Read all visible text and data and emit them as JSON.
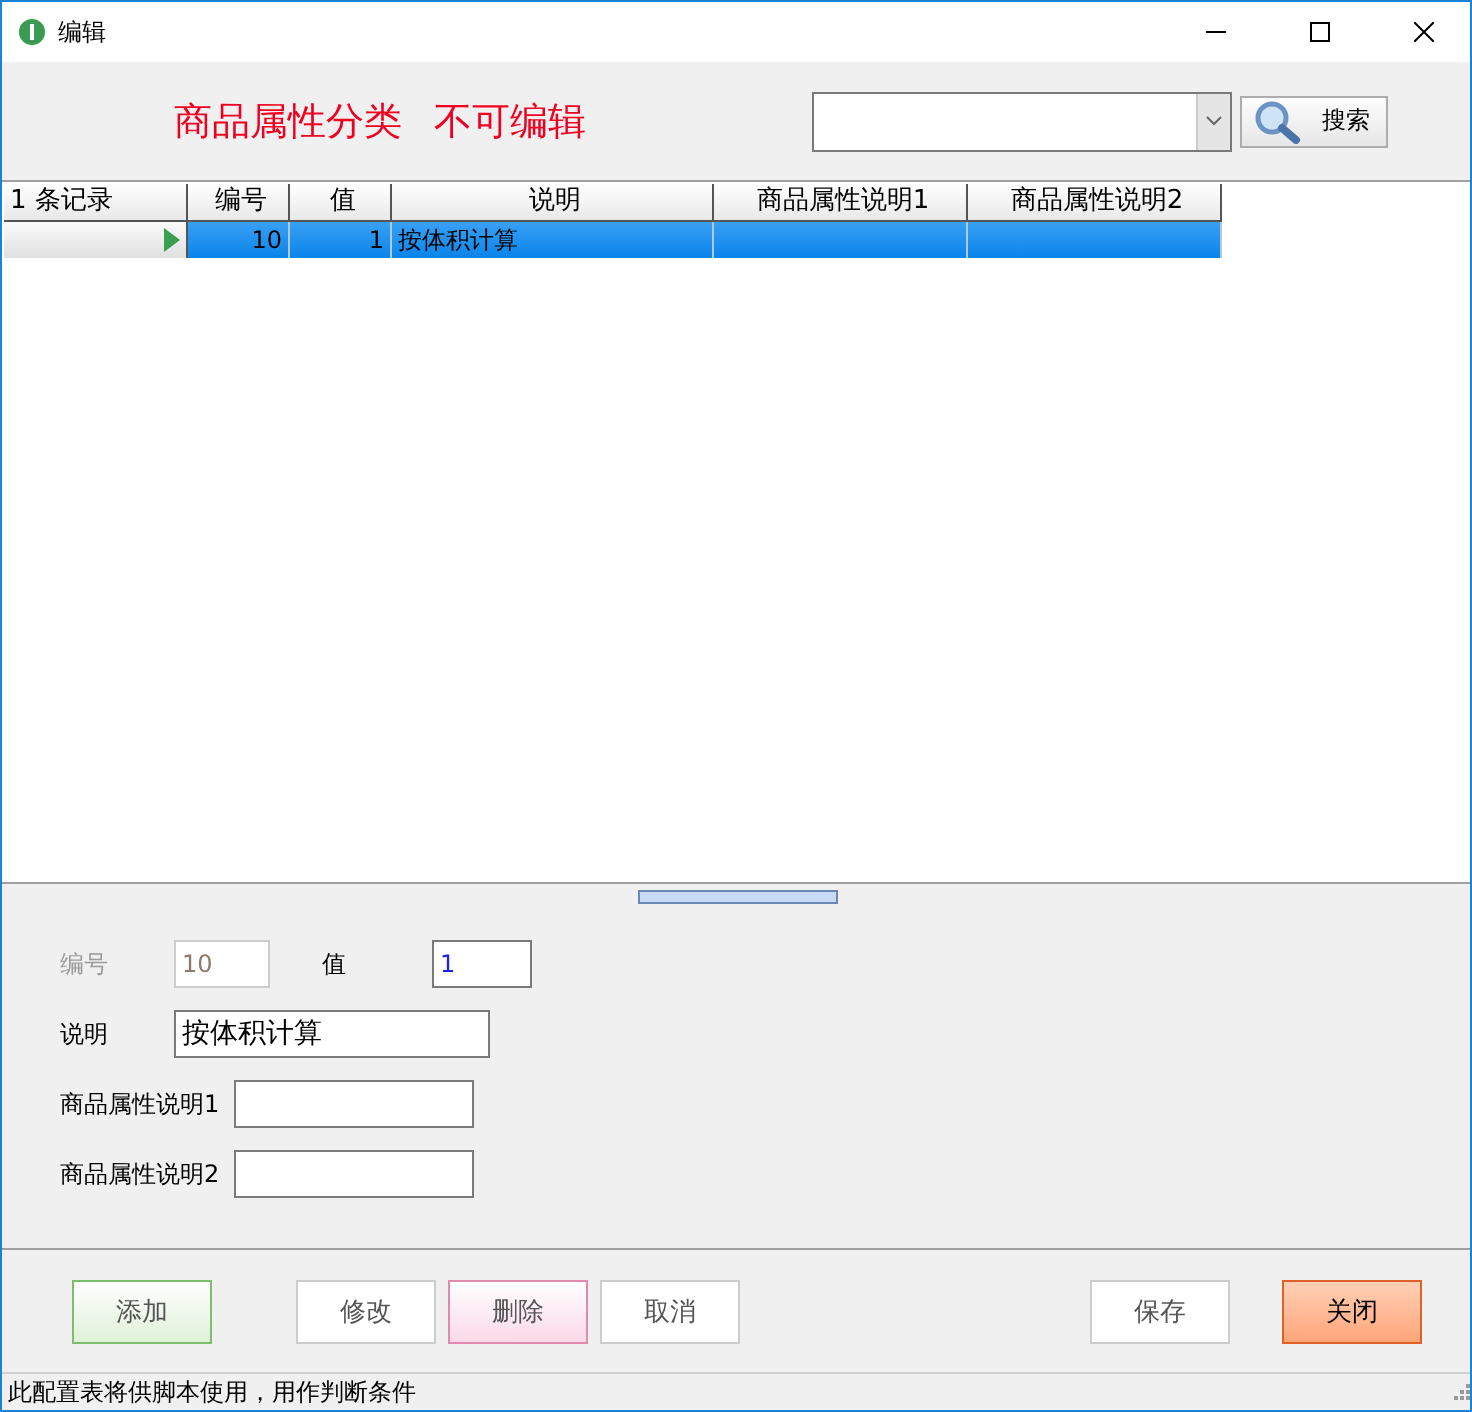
{
  "window": {
    "title": "编辑"
  },
  "header": {
    "labels": [
      "商品属性分类",
      "不可编辑"
    ],
    "search_button": "搜索"
  },
  "grid": {
    "record_count": "1 条记录",
    "columns": [
      "编号",
      "值",
      "说明",
      "商品属性说明1",
      "商品属性说明2"
    ],
    "rows": [
      {
        "selected": true,
        "cells": [
          "10",
          "1",
          "按体积计算"
        ]
      }
    ]
  },
  "form": [
    {
      "label": "编号",
      "value": "10",
      "disabled": true,
      "kind": "number"
    },
    {
      "label": "值",
      "value": "1",
      "disabled": false,
      "kind": "number"
    },
    {
      "label": "说明",
      "value": "按体积计算",
      "disabled": false,
      "kind": "text"
    },
    {
      "label": "商品属性说明1",
      "disabled": false,
      "kind": "text"
    },
    {
      "label": "商品属性说明2",
      "disabled": false,
      "kind": "text"
    }
  ],
  "buttons": [
    {
      "label": "添加",
      "kind": "add"
    },
    {
      "label": "修改",
      "kind": "plain"
    },
    {
      "label": "删除",
      "kind": "delete"
    },
    {
      "label": "取消",
      "kind": "plain"
    },
    {
      "label": "保存",
      "kind": "plain"
    },
    {
      "label": "关闭",
      "kind": "close"
    }
  ],
  "status_bar": "此配置表将供脚本使用，用作判断条件"
}
